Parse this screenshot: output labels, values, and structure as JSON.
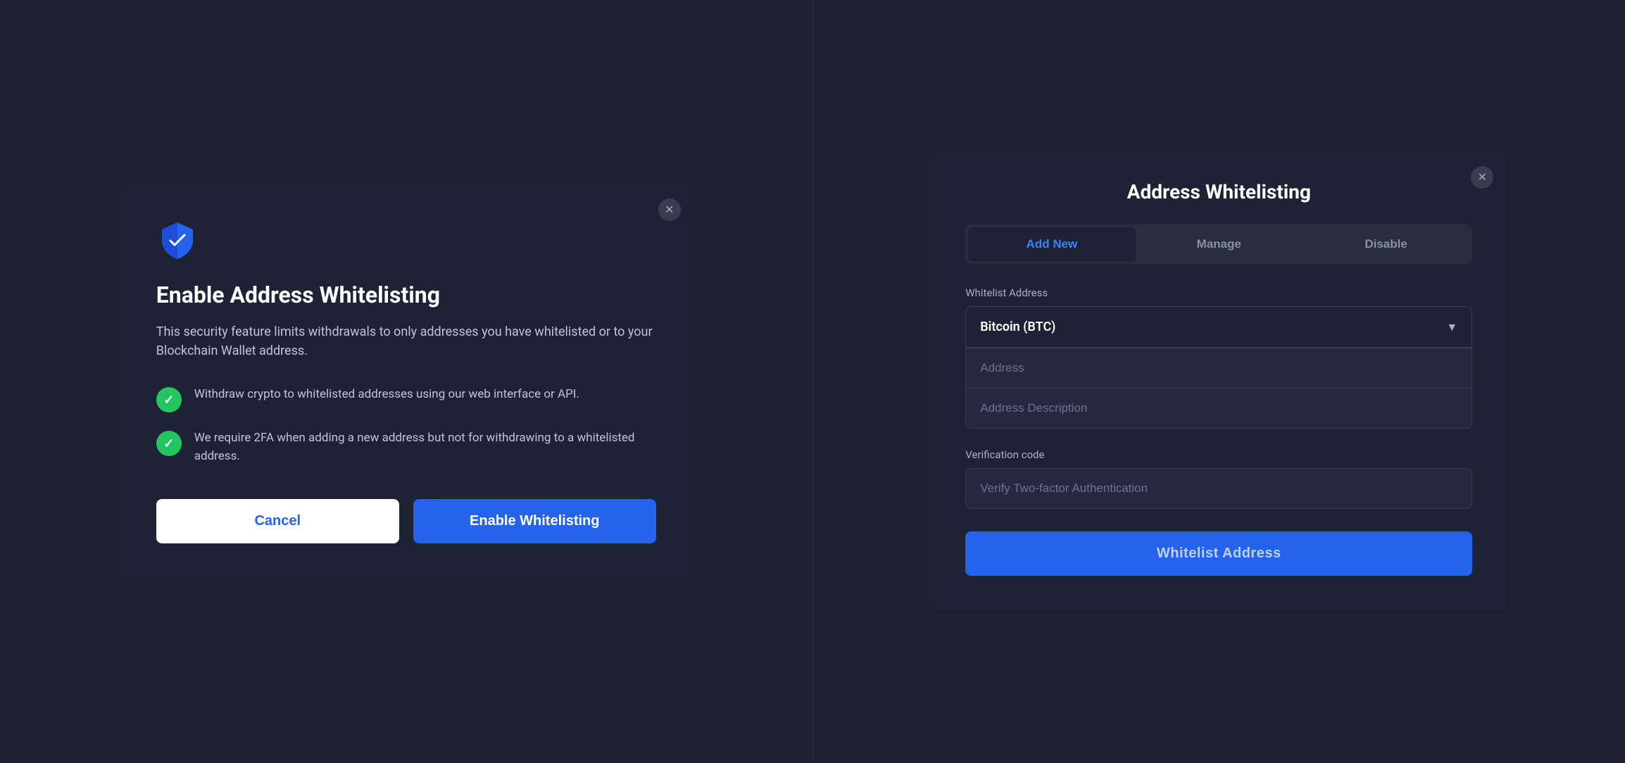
{
  "left_modal": {
    "title": "Enable Address Whitelisting",
    "description": "This security feature limits withdrawals to only addresses you have whitelisted or to your Blockchain Wallet address.",
    "features": [
      {
        "text": "Withdraw crypto to whitelisted addresses using our web interface or API."
      },
      {
        "text": "We require 2FA when adding a new address but not for withdrawing to a whitelisted address."
      }
    ],
    "cancel_label": "Cancel",
    "enable_label": "Enable Whitelisting"
  },
  "right_modal": {
    "title": "Address Whitelisting",
    "tabs": [
      {
        "label": "Add New",
        "active": true
      },
      {
        "label": "Manage",
        "active": false
      },
      {
        "label": "Disable",
        "active": false
      }
    ],
    "whitelist_address_label": "Whitelist Address",
    "currency_value": "Bitcoin (BTC)",
    "address_placeholder": "Address",
    "address_description_placeholder": "Address Description",
    "verification_label": "Verification code",
    "verification_placeholder": "Verify Two-factor Authentication",
    "submit_label": "Whitelist Address"
  }
}
